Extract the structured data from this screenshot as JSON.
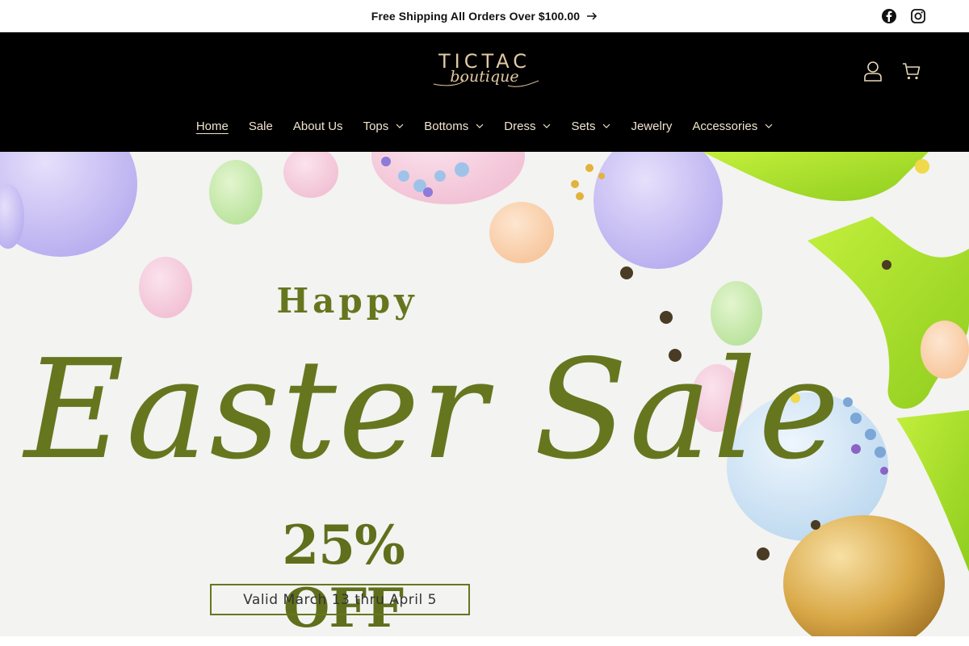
{
  "announcement": {
    "text": "Free Shipping All Orders Over $100.00",
    "social_icons": [
      "facebook-icon",
      "instagram-icon"
    ]
  },
  "header": {
    "logo_main": "TICTAC",
    "logo_script": "boutique",
    "icons": [
      "account-icon",
      "cart-icon"
    ]
  },
  "nav": {
    "items": [
      {
        "label": "Home",
        "active": true,
        "dropdown": false
      },
      {
        "label": "Sale",
        "active": false,
        "dropdown": false
      },
      {
        "label": "About Us",
        "active": false,
        "dropdown": false
      },
      {
        "label": "Tops",
        "active": false,
        "dropdown": true
      },
      {
        "label": "Bottoms",
        "active": false,
        "dropdown": true
      },
      {
        "label": "Dress",
        "active": false,
        "dropdown": true
      },
      {
        "label": "Sets",
        "active": false,
        "dropdown": true
      },
      {
        "label": "Jewelry",
        "active": false,
        "dropdown": false
      },
      {
        "label": "Accessories",
        "active": false,
        "dropdown": true
      }
    ]
  },
  "hero": {
    "happy": "Happy",
    "headline": "Easter Sale",
    "discount": "25% OFF",
    "validity": "Valid March 13 thru April 5"
  },
  "colors": {
    "header_bg": "#000000",
    "accent_green": "#66761f",
    "logo_gold": "#e3c9a2",
    "nav_text": "#f0e4cf"
  }
}
